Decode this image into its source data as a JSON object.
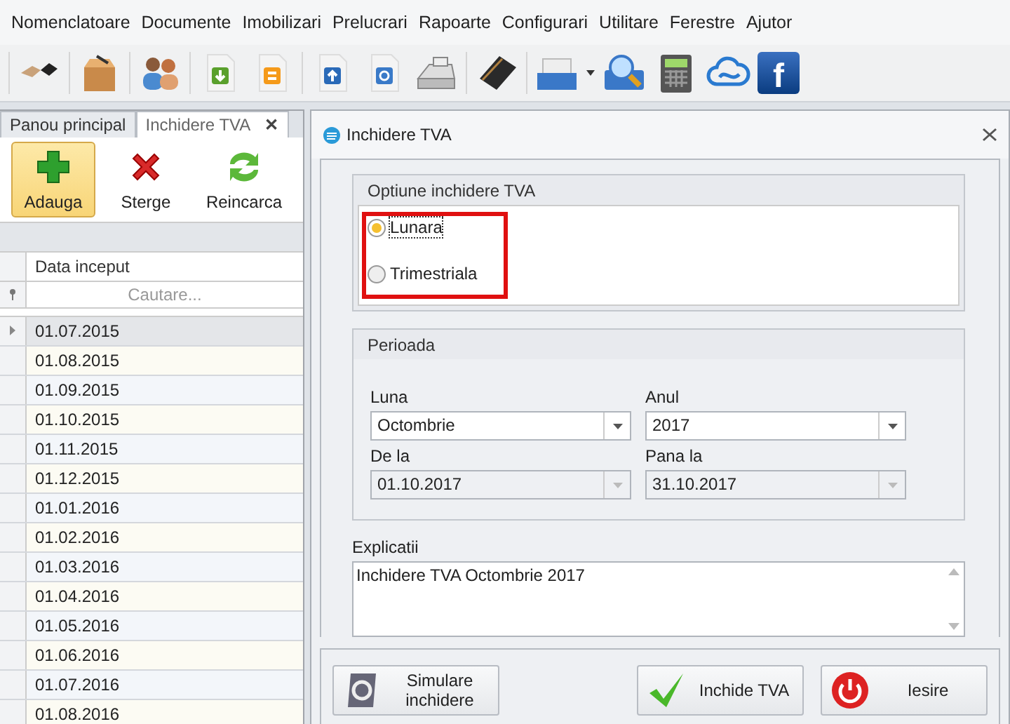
{
  "menu": [
    "Nomenclatoare",
    "Documente",
    "Imobilizari",
    "Prelucrari",
    "Rapoarte",
    "Configurari",
    "Utilitare",
    "Ferestre",
    "Ajutor"
  ],
  "toolbar": {
    "logo_letter": "f"
  },
  "tabs": [
    {
      "label": "Panou principal",
      "selected": false,
      "closable": false
    },
    {
      "label": "Inchidere TVA",
      "selected": true,
      "closable": true
    }
  ],
  "tab_close": "✕",
  "ribbon": [
    {
      "label": "Adauga",
      "kind": "add",
      "selected": true
    },
    {
      "label": "Sterge",
      "kind": "delete",
      "selected": false
    },
    {
      "label": "Reincarca",
      "kind": "reload",
      "selected": false
    }
  ],
  "grid": {
    "column": "Data inceput",
    "search": {
      "placeholder": "Cautare..."
    },
    "rows": [
      {
        "date": "01.07.2015",
        "selected": true
      },
      {
        "date": "01.08.2015",
        "selected": false
      },
      {
        "date": "01.09.2015",
        "selected": false
      },
      {
        "date": "01.10.2015",
        "selected": false
      },
      {
        "date": "01.11.2015",
        "selected": false
      },
      {
        "date": "01.12.2015",
        "selected": false
      },
      {
        "date": "01.01.2016",
        "selected": false
      },
      {
        "date": "01.02.2016",
        "selected": false
      },
      {
        "date": "01.03.2016",
        "selected": false
      },
      {
        "date": "01.04.2016",
        "selected": false
      },
      {
        "date": "01.05.2016",
        "selected": false
      },
      {
        "date": "01.06.2016",
        "selected": false
      },
      {
        "date": "01.07.2016",
        "selected": false
      },
      {
        "date": "01.08.2016",
        "selected": false
      }
    ]
  },
  "dialog": {
    "title": "Inchidere TVA",
    "options": {
      "title": "Optiune inchidere TVA",
      "highlighted": true,
      "items": [
        {
          "label": "Lunara",
          "selected": true
        },
        {
          "label": "Trimestriala",
          "selected": false
        }
      ]
    },
    "period": {
      "title": "Perioada",
      "fields": [
        {
          "label": "Luna",
          "value": "Octombrie",
          "disabled": false
        },
        {
          "label": "Anul",
          "value": "2017",
          "disabled": false
        },
        {
          "label": "De la",
          "value": "01.10.2017",
          "disabled": true
        },
        {
          "label": "Pana la",
          "value": "31.10.2017",
          "disabled": true
        }
      ]
    },
    "notes": {
      "label": "Explicatii",
      "value": "Inchidere TVA Octombrie 2017"
    },
    "buttons": [
      {
        "label": "Simulare inchidere",
        "kind": "simulate"
      },
      {
        "label": "Inchide TVA",
        "kind": "close"
      },
      {
        "label": "Iesire",
        "kind": "exit"
      }
    ]
  }
}
